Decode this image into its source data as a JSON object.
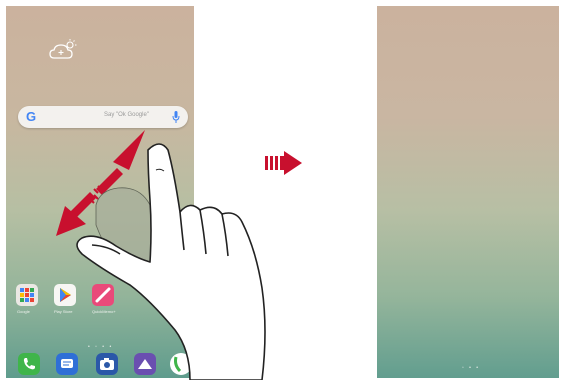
{
  "left_screen": {
    "search": {
      "logo": "G",
      "hint": "Say \"Ok Google\""
    },
    "apps": [
      {
        "icon": "folder-grid-icon",
        "label": "Google",
        "color": "#e9e6e2"
      },
      {
        "icon": "play-store-icon",
        "label": "Play Store",
        "color": "#f7f6f4"
      },
      {
        "icon": "pen-icon",
        "label": "QuickMemo+",
        "color": "#e94a7a"
      }
    ],
    "page_indicator": "• ▫ • •",
    "dock": [
      {
        "icon": "phone-icon",
        "color": "#3fb54a"
      },
      {
        "icon": "messages-icon",
        "color": "#2f6fd6"
      },
      {
        "icon": "camera-icon",
        "color": "#2b58a8"
      },
      {
        "icon": "gallery-icon",
        "color": "#6a4fb0"
      },
      {
        "icon": "phone-partial-icon",
        "color": "#ffffff"
      }
    ]
  },
  "right_screen": {
    "page_indicator": "▫ • •"
  },
  "colors": {
    "arrow": "#c8102e",
    "gesture_area": "#a7ae99"
  }
}
